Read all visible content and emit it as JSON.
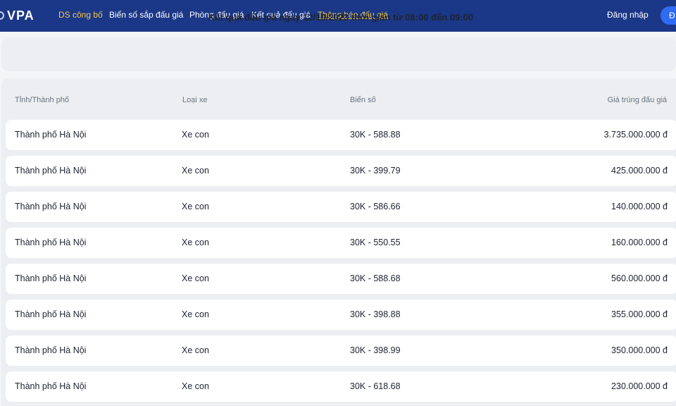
{
  "header": {
    "logo": "VPA",
    "nav": [
      "DS công bố",
      "Biển số sắp đấu giá",
      "Phòng đấu giá",
      "Kết quả đấu giá",
      "Thông báo đấu giá"
    ],
    "login": "Đăng nhập",
    "button_partial": "Đ"
  },
  "main": {
    "title": "Kết quả đấu giá ngày 12/10/2023 thời gian từ 08:00 đến 09:00",
    "columns": [
      "Tỉnh/Thành phố",
      "Loại xe",
      "Biển số",
      "Giá trúng đấu giá"
    ],
    "rows": [
      [
        "Thành phố Hà Nội",
        "Xe con",
        "30K - 588.88",
        "3.735.000.000 đ"
      ],
      [
        "Thành phố Hà Nội",
        "Xe con",
        "30K - 399.79",
        "425.000.000 đ"
      ],
      [
        "Thành phố Hà Nội",
        "Xe con",
        "30K - 586.66",
        "140.000.000 đ"
      ],
      [
        "Thành phố Hà Nội",
        "Xe con",
        "30K - 550.55",
        "160.000.000 đ"
      ],
      [
        "Thành phố Hà Nội",
        "Xe con",
        "30K - 588.68",
        "560.000.000 đ"
      ],
      [
        "Thành phố Hà Nội",
        "Xe con",
        "30K - 398.88",
        "355.000.000 đ"
      ],
      [
        "Thành phố Hà Nội",
        "Xe con",
        "30K - 398.99",
        "350.000.000 đ"
      ],
      [
        "Thành phố Hà Nội",
        "Xe con",
        "30K - 618.68",
        "230.000.000 đ"
      ]
    ]
  },
  "colors": {
    "header_bg": "#1b3787",
    "nav_active": "#f2c94c",
    "button": "#2f6bf2"
  }
}
